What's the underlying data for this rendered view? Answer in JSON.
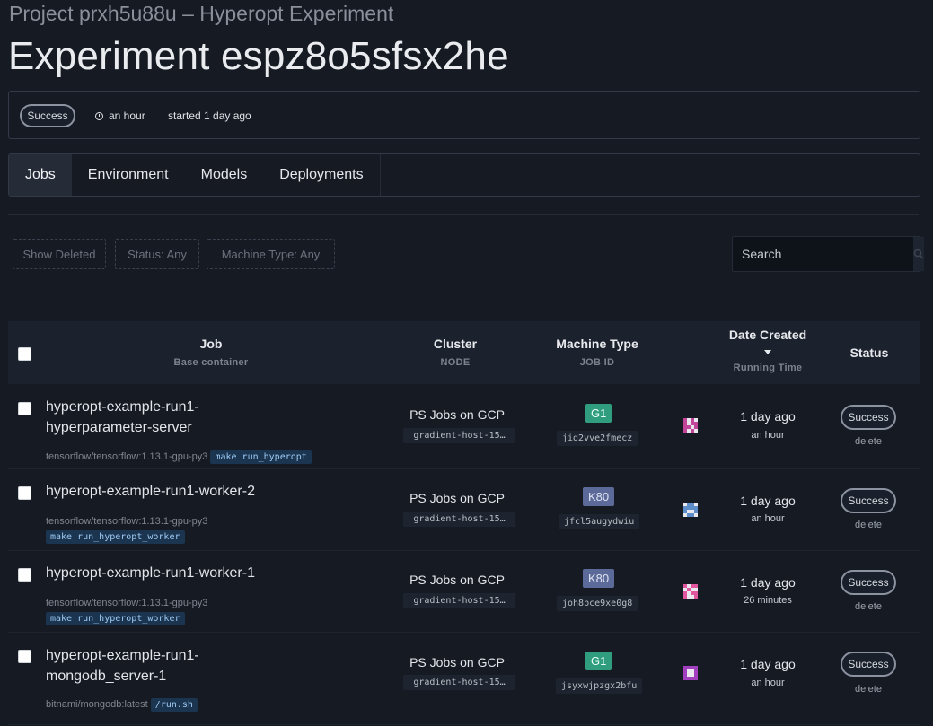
{
  "header": {
    "project": "Project prxh5u88u – Hyperopt Experiment",
    "title": "Experiment espz8o5sfsx2he"
  },
  "summary": {
    "status": "Success",
    "duration": "an hour",
    "started": "started 1 day ago"
  },
  "tabs": [
    "Jobs",
    "Environment",
    "Models",
    "Deployments"
  ],
  "filters": {
    "show_deleted": "Show Deleted",
    "status": "Status: Any",
    "machine_type": "Machine Type: Any"
  },
  "search": {
    "placeholder": "Search"
  },
  "table": {
    "columns": {
      "job": "Job",
      "job_sub": "Base container",
      "cluster": "Cluster",
      "cluster_sub": "NODE",
      "machine": "Machine Type",
      "machine_sub": "JOB ID",
      "date": "Date Created",
      "date_sub": "Running Time",
      "status": "Status"
    },
    "rows": [
      {
        "name_line1": "hyperopt-example-run1-",
        "name_line2": "hyperparameter-server",
        "container": "tensorflow/tensorflow:1.13.1-gpu-py3",
        "command": "make run_hyperopt",
        "cluster": "PS Jobs on GCP",
        "node": "gradient-host-15…",
        "machine": "G1",
        "job_id": "jig2vve2fmecz",
        "date": "1 day ago",
        "running": "an hour",
        "status": "Success",
        "delete": "delete",
        "avatar_color": "#c2459a"
      },
      {
        "name_line1": "hyperopt-example-run1-worker-2",
        "name_line2": "",
        "container": "tensorflow/tensorflow:1.13.1-gpu-py3",
        "command": "make run_hyperopt_worker",
        "cluster": "PS Jobs on GCP",
        "node": "gradient-host-15…",
        "machine": "K80",
        "job_id": "jfcl5augydwiu",
        "date": "1 day ago",
        "running": "an hour",
        "status": "Success",
        "delete": "delete",
        "avatar_color": "#5e8ec9"
      },
      {
        "name_line1": "hyperopt-example-run1-worker-1",
        "name_line2": "",
        "container": "tensorflow/tensorflow:1.13.1-gpu-py3",
        "command": "make run_hyperopt_worker",
        "cluster": "PS Jobs on GCP",
        "node": "gradient-host-15…",
        "machine": "K80",
        "job_id": "joh8pce9xe0g8",
        "date": "1 day ago",
        "running": "26 minutes",
        "status": "Success",
        "delete": "delete",
        "avatar_color": "#e0569f"
      },
      {
        "name_line1": "hyperopt-example-run1-",
        "name_line2": "mongodb_server-1",
        "container": "bitnami/mongodb:latest",
        "command": "/run.sh",
        "cluster": "PS Jobs on GCP",
        "node": "gradient-host-15…",
        "machine": "G1",
        "job_id": "jsyxwjpzgx2bfu",
        "date": "1 day ago",
        "running": "an hour",
        "status": "Success",
        "delete": "delete",
        "avatar_color": "#a23fbf"
      }
    ]
  }
}
